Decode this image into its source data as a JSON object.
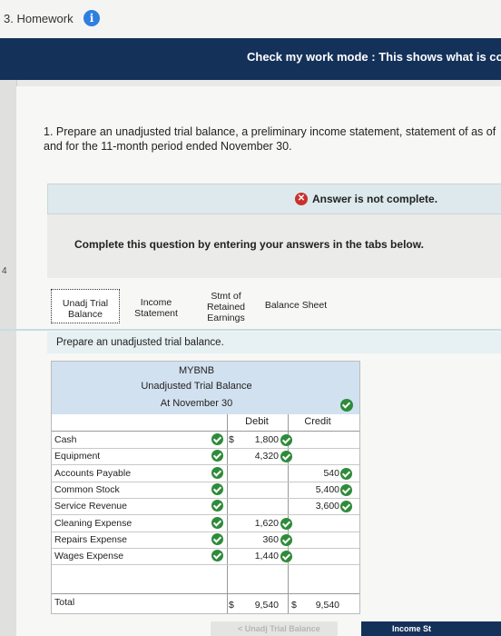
{
  "homework": {
    "title": "3. Homework",
    "info_icon": "info-icon",
    "info_glyph": "i"
  },
  "header": {
    "text": "Check my work mode : This shows what is co"
  },
  "gutter": {
    "number": "4"
  },
  "question": {
    "text": "1. Prepare an unadjusted trial balance, a preliminary income statement, statement of as of and for the 11-month period ended November 30."
  },
  "answer_status": {
    "icon": "x-icon",
    "glyph": "✕",
    "text": "Answer is not complete."
  },
  "instructions": {
    "text": "Complete this question by entering your answers in the tabs below."
  },
  "tabs": [
    {
      "label": "Unadj Trial Balance",
      "line1": "Unadj Trial",
      "line2": "Balance",
      "active": true
    },
    {
      "label": "Income Statement",
      "line1": "Income",
      "line2": "Statement",
      "active": false
    },
    {
      "label": "Stmt of Retained Earnings",
      "line1": "Stmt of",
      "line2": "Retained",
      "line3": "Earnings",
      "active": false
    },
    {
      "label": "Balance Sheet",
      "line1": "Balance Sheet",
      "active": false
    }
  ],
  "prompt": {
    "text": "Prepare an unadjusted trial balance."
  },
  "worksheet": {
    "company": "MYBNB",
    "title": "Unadjusted Trial Balance",
    "date": "At November 30",
    "debit_header": "Debit",
    "credit_header": "Credit",
    "rows": [
      {
        "account": "Cash",
        "dollar": "$",
        "debit": "1,800",
        "credit": ""
      },
      {
        "account": "Equipment",
        "dollar": "",
        "debit": "4,320",
        "credit": ""
      },
      {
        "account": "Accounts Payable",
        "dollar": "",
        "debit": "",
        "credit": "540"
      },
      {
        "account": "Common Stock",
        "dollar": "",
        "debit": "",
        "credit": "5,400"
      },
      {
        "account": "Service Revenue",
        "dollar": "",
        "debit": "",
        "credit": "3,600"
      },
      {
        "account": "Cleaning Expense",
        "dollar": "",
        "debit": "1,620",
        "credit": ""
      },
      {
        "account": "Repairs Expense",
        "dollar": "",
        "debit": "360",
        "credit": ""
      },
      {
        "account": "Wages Expense",
        "dollar": "",
        "debit": "1,440",
        "credit": ""
      }
    ],
    "total": {
      "label": "Total",
      "debit_dollar": "$",
      "debit": "9,540",
      "credit_dollar": "$",
      "credit": "9,540"
    }
  },
  "nav": {
    "prev": "Unadj Trial Balance",
    "prev_glyph": "<",
    "next": "Income St"
  },
  "colors": {
    "header": "#14315a",
    "check": "#2e8b3a",
    "error": "#c9302c",
    "info": "#2e7fe0"
  }
}
